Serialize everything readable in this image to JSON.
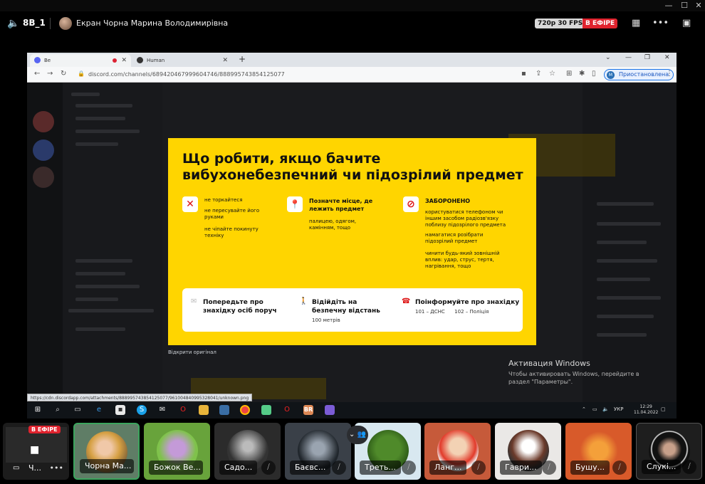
{
  "window_controls": [
    "—",
    "☐",
    "✕"
  ],
  "header": {
    "channel": "8B_1",
    "title": "Екран Чорна Марина Володимирівна",
    "quality": "720p 30 FPS",
    "live": "В ЕФІРЕ"
  },
  "browser": {
    "tabs": [
      {
        "label": "Ве"
      },
      {
        "label": "Human"
      }
    ],
    "url": "discord.com/channels/689420467999604746/888995743854125077",
    "profile_label": "Приостановлена",
    "profile_initial": "М",
    "status_url": "https://cdn.discordapp.com/attachments/888995743854125077/961004840995328041/unknown.png"
  },
  "poster": {
    "title": "Що робити, якщо бачите вибухонебезпечний чи підозрілий предмет",
    "col1": {
      "items": [
        "не торкайтеся",
        "не пересувайте його руками",
        "не чіпайте покинуту техніку"
      ]
    },
    "col2": {
      "heading": "Позначте місце, де лежить предмет",
      "text": "палицею, одягом, камінням, тощо"
    },
    "col3": {
      "heading": "ЗАБОРОНЕНО",
      "items": [
        "користуватися телефоном чи іншим засобом радіозв'язку поблизу підозрілого предмета",
        "намагатися розібрати підозрілий предмет",
        "чинити будь-який зовнішній вплив: удар, струс, тертя, нагрівання, тощо"
      ]
    },
    "card": [
      {
        "head": "Попередьте про знахідку осіб поруч",
        "sub": ""
      },
      {
        "head": "Відійдіть на безпечну відстань",
        "sub": "100 метрів"
      },
      {
        "head": "Поінформуйте про знахідку",
        "sub": "101 – ДСНС      102 – Поліція"
      }
    ]
  },
  "open_original": "Відкрити оригінал",
  "activation": {
    "heading": "Активация Windows",
    "text": "Чтобы активировать Windows, перейдите в раздел \"Параметры\"."
  },
  "taskbar": {
    "lang": "УКР",
    "time": "12:29",
    "date": "11.04.2022"
  },
  "participants": [
    {
      "name": "Ч...",
      "live": "В ЕФІРЕ"
    },
    {
      "name": "Чорна Ма..."
    },
    {
      "name": "Божок Ве..."
    },
    {
      "name": "Садо..."
    },
    {
      "name": "Баєвс..."
    },
    {
      "name": "Треть..."
    },
    {
      "name": "Ланг..."
    },
    {
      "name": "Гаври..."
    },
    {
      "name": "Бушу..."
    },
    {
      "name": "Слукі..."
    }
  ],
  "colors": {
    "live_red": "#e0232e",
    "poster_yellow": "#ffd500",
    "discord_dark": "#1a1b1e"
  }
}
